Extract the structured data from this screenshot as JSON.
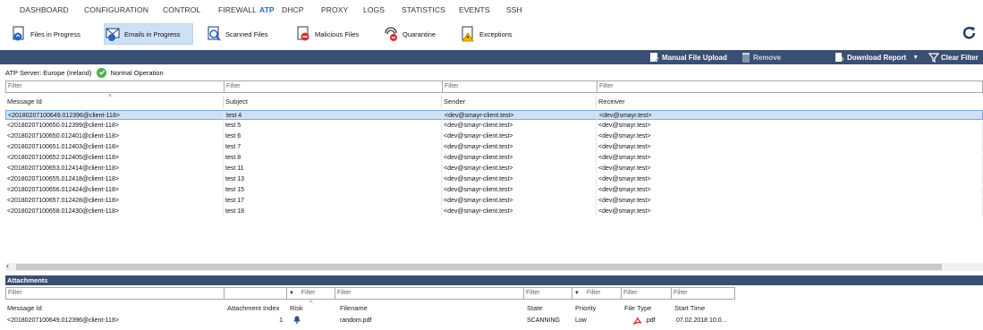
{
  "nav": {
    "items": [
      "DASHBOARD",
      "CONFIGURATION",
      "CONTROL",
      "FIREWALL",
      "ATP",
      "DHCP",
      "PROXY",
      "LOGS",
      "STATISTICS",
      "EVENTS",
      "SSH"
    ],
    "active": "ATP"
  },
  "toolbar": {
    "files_in_progress": "Files in Progress",
    "emails_in_progress": "Emails in Progress",
    "scanned_files": "Scanned Files",
    "malicious_files": "Malicious Files",
    "quarantine": "Quarantine",
    "exceptions": "Exceptions"
  },
  "actions": {
    "manual_upload": "Manual File Upload",
    "remove": "Remove",
    "download_report": "Download Report",
    "clear_filter": "Clear Filter"
  },
  "status": {
    "server": "ATP Server: Europe (Ireland)",
    "operation": "Normal Operation"
  },
  "emails": {
    "filter_placeholder": "Filter",
    "columns": [
      "Message Id",
      "Subject",
      "Sender",
      "Receiver"
    ],
    "rows": [
      [
        "<20180207100649.012396@client-118>",
        "test 4",
        "<dev@smayr-client.test>",
        "<dev@smayr.test>"
      ],
      [
        "<20180207100650.012399@client-118>",
        "test 5",
        "<dev@smayr-client.test>",
        "<dev@smayr.test>"
      ],
      [
        "<20180207100650.012401@client-118>",
        "test 6",
        "<dev@smayr-client.test>",
        "<dev@smayr.test>"
      ],
      [
        "<20180207100651.012403@client-118>",
        "test 7",
        "<dev@smayr-client.test>",
        "<dev@smayr.test>"
      ],
      [
        "<20180207100652.012405@client-118>",
        "test 8",
        "<dev@smayr-client.test>",
        "<dev@smayr.test>"
      ],
      [
        "<20180207100653.012414@client-118>",
        "test 11",
        "<dev@smayr-client.test>",
        "<dev@smayr.test>"
      ],
      [
        "<20180207100655.012418@client-118>",
        "test 13",
        "<dev@smayr-client.test>",
        "<dev@smayr.test>"
      ],
      [
        "<20180207100656.012424@client-118>",
        "test 15",
        "<dev@smayr-client.test>",
        "<dev@smayr.test>"
      ],
      [
        "<20180207100657.012428@client-118>",
        "test 17",
        "<dev@smayr-client.test>",
        "<dev@smayr.test>"
      ],
      [
        "<20180207100658.012430@client-118>",
        "test 18",
        "<dev@smayr-client.test>",
        "<dev@smayr.test>"
      ]
    ]
  },
  "attachments": {
    "title": "Attachments",
    "filter_placeholder": "Filter",
    "columns": [
      "Message Id",
      "Attachment Index",
      "Risk",
      "Filename",
      "State",
      "Priority",
      "File Type",
      "Start Time"
    ],
    "row": {
      "message_id": "<20180207100649.012396@client-118>",
      "index": "1",
      "filename": "random.pdf",
      "state": "SCANNING",
      "priority": "Low",
      "file_type": ".pdf",
      "start_time": "07.02.2018 10:0..."
    }
  },
  "colors": {
    "accent": "#2b62c6",
    "bar": "#3a4f74",
    "selected": "#cde1f5",
    "ok": "#4caf50"
  }
}
